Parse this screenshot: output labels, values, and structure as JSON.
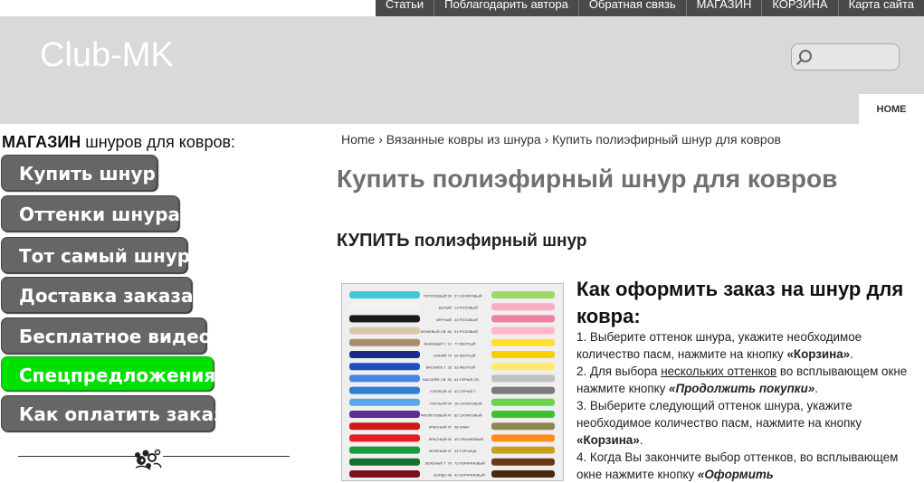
{
  "topnav": {
    "items": [
      "Статьи",
      "Поблагодарить автора",
      "Обратная связь",
      "МАГАЗИН",
      "КОРЗИНА",
      "Карта сайта"
    ]
  },
  "header": {
    "site_title": "Club-MK",
    "home_tab": "HOME",
    "search_placeholder": ""
  },
  "sidebar": {
    "heading_bold": "МАГАЗИН",
    "heading_rest": " шнуров для ковров:",
    "menu": [
      {
        "label": "Купить шнур"
      },
      {
        "label": "Оттенки шнура"
      },
      {
        "label": "Тот самый шнур"
      },
      {
        "label": "Доставка заказа"
      },
      {
        "label": "Бесплатное видео"
      },
      {
        "label": "Спецпредложения"
      },
      {
        "label": "Как оплатить заказ"
      }
    ]
  },
  "main": {
    "breadcrumb": "Home › Вязанные ковры из шнура › Купить полиэфирный шнур для ковров",
    "page_title": "Купить полиэфирный шнур для ковров",
    "section_bold": "КУПИТЬ",
    "section_rest": " полиэфирный шнур",
    "instructions_heading": "Как оформить заказ на шнур для ковра:",
    "steps": {
      "s1_a": "1. Выберите оттенок шнура, укажите необходимое количество пасм, нажмите на кнопку ",
      "s1_b": "«Корзина»",
      "s1_c": ".",
      "s2_a": "2. Для выбора ",
      "s2_link": "нескольких оттенков",
      "s2_b": " во всплывающем окне нажмите кнопку ",
      "s2_c": "«Продолжить покупки»",
      "s2_d": ".",
      "s3_a": "3. Выберите следующий оттенок шнура, укажите необходимое количество пасм, нажмите на кнопку ",
      "s3_b": "«Корзина»",
      "s3_c": ".",
      "s4_a": "4. Когда Вы закончите выбор оттенков, во всплывающем окне нажмите кнопку ",
      "s4_b": "«Оформить"
    },
    "color_chart": {
      "left_labels": [
        "ТОПОЛЕВЫЙ 54",
        "БЕЛЫЙ",
        "ЧЁРНЫЙ",
        "БЕЖЕВЫЙ СВ. 65",
        "БЕЖЕВЫЙ Т. 12",
        "СИНИЙ 75",
        "ВАСИЛЁК Т. 33",
        "ВАСИЛЁК СВ. 55",
        "ГОЛУБОЙ 43",
        "ГОЛУБОЙ 04",
        "ФИОЛЕТОВЫЙ 47",
        "КРАСНЫЙ 47",
        "КРАСНЫЙ 65",
        "ЗЕЛЁНЫЙ 57",
        "ЗЕЛЁНЫЙ Т. 79",
        "БОРДО 46"
      ],
      "right_labels": [
        "27 САЛАТОВЫЙ",
        "13 РОЗОВЫЙ",
        "23 РОЗОВЫЙ",
        "51 РОЗОВЫЙ",
        "77 ЖЁЛТЫЙ",
        "26 ЖЁЛТЫЙ",
        "33 ЖЁЛТЫЙ",
        "64 СЕРЫЙ СВ.",
        "42 СЕРЫЙ Т.",
        "16 САЛАТОВЫЙ",
        "82 САЛАТОВЫЙ",
        "98 ХАКИ",
        "49 ОРАНЖЕВЫЙ",
        "44 ГОРЧИЦА",
        "72 КОРИЧНЕВЫЙ",
        "42 КОРИЧНЕВЫЙ"
      ],
      "left_colors": [
        "#3fc9d6",
        "#f2f2f2",
        "#1a1a1a",
        "#d9c9a8",
        "#a88c6a",
        "#1c2a8a",
        "#1f4ec0",
        "#4a86e0",
        "#2e7fd0",
        "#58a8e8",
        "#5a3090",
        "#d01818",
        "#e02020",
        "#1a9a3a",
        "#157030",
        "#7a1020"
      ],
      "right_colors": [
        "#9ed868",
        "#f4b0c0",
        "#f080a0",
        "#ffb8c8",
        "#ffe030",
        "#f5d000",
        "#ffea70",
        "#c0c0c0",
        "#7a7a7a",
        "#70d050",
        "#40c030",
        "#8a8a50",
        "#ff8a20",
        "#c8a020",
        "#6a3a18",
        "#4a2810"
      ]
    }
  }
}
